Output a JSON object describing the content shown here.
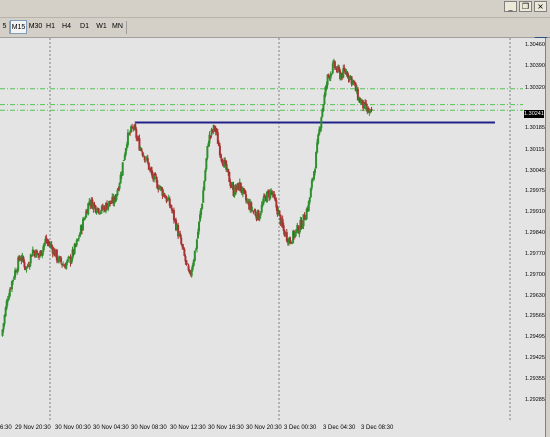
{
  "window_controls": [
    {
      "name": "minimize-button",
      "glyph": "_"
    },
    {
      "name": "restore-button",
      "glyph": "❐"
    },
    {
      "name": "close-button",
      "glyph": "×"
    }
  ],
  "timeframes": {
    "items": [
      "5",
      "M15",
      "M30",
      "H1",
      "H4",
      "D1",
      "W1",
      "MN"
    ],
    "selected": "M15"
  },
  "toolbar_icon": "chat-icon",
  "price_axis": {
    "labels": [
      "1.30460",
      "1.30390",
      "1.30320",
      "1.30241",
      "1.30185",
      "1.30115",
      "1.30045",
      "1.29975",
      "1.29910",
      "1.29840",
      "1.29770",
      "1.29700",
      "1.29630",
      "1.29565",
      "1.29495",
      "1.29425",
      "1.29355",
      "1.29285"
    ],
    "current_price": "1.30241"
  },
  "time_axis": {
    "labels": [
      "6:30",
      "29 Nov 20:30",
      "30 Nov 00:30",
      "30 Nov 04:30",
      "30 Nov 08:30",
      "30 Nov 12:30",
      "30 Nov 16:30",
      "30 Nov 20:30",
      "3 Dec 00:30",
      "3 Dec 04:30",
      "3 Dec 08:30"
    ]
  },
  "colors": {
    "bull": "#2d8f2d",
    "bear": "#a83232",
    "support_line": "#22228a",
    "level_lines": "#55c455",
    "background": "#e4e4e4",
    "grid_separator": "#808080"
  },
  "chart_data": {
    "type": "candlestick",
    "symbol_timeframe": "M15",
    "horizontal_lines": [
      {
        "role": "support",
        "price": 1.30225,
        "style": "solid",
        "color": "#22228a"
      },
      {
        "role": "level",
        "price": 1.30265,
        "style": "dash-dot",
        "color": "#55c455"
      },
      {
        "role": "level",
        "price": 1.30283,
        "style": "dash-dot",
        "color": "#55c455"
      },
      {
        "role": "level",
        "price": 1.30335,
        "style": "dash-dot",
        "color": "#55c455"
      }
    ],
    "session_separators": [
      "29 Nov 20:30",
      "30 Nov 20:30",
      "3 Dec 08:30"
    ],
    "ylim": [
      1.2925,
      1.305
    ],
    "close_path": [
      1.2953,
      1.2966,
      1.2973,
      1.2979,
      1.2975,
      1.2981,
      1.2979,
      1.2984,
      1.2982,
      1.2978,
      1.2976,
      1.2978,
      1.2983,
      1.299,
      1.2997,
      1.2995,
      1.2994,
      1.2996,
      1.2997,
      1.3005,
      1.3017,
      1.3021,
      1.3015,
      1.3011,
      1.3005,
      1.3002,
      1.2999,
      1.2995,
      1.2988,
      1.298,
      1.2972,
      1.2982,
      1.2997,
      1.3017,
      1.3021,
      1.3012,
      1.3006,
      1.3,
      1.3002,
      1.2997,
      1.2994,
      1.2992,
      1.2998,
      1.3,
      1.2994,
      1.2987,
      1.2984,
      1.2987,
      1.299,
      1.2996,
      1.3009,
      1.3025,
      1.3037,
      1.3041,
      1.3038,
      1.3039,
      1.3036,
      1.303,
      1.3027,
      1.3025
    ]
  }
}
